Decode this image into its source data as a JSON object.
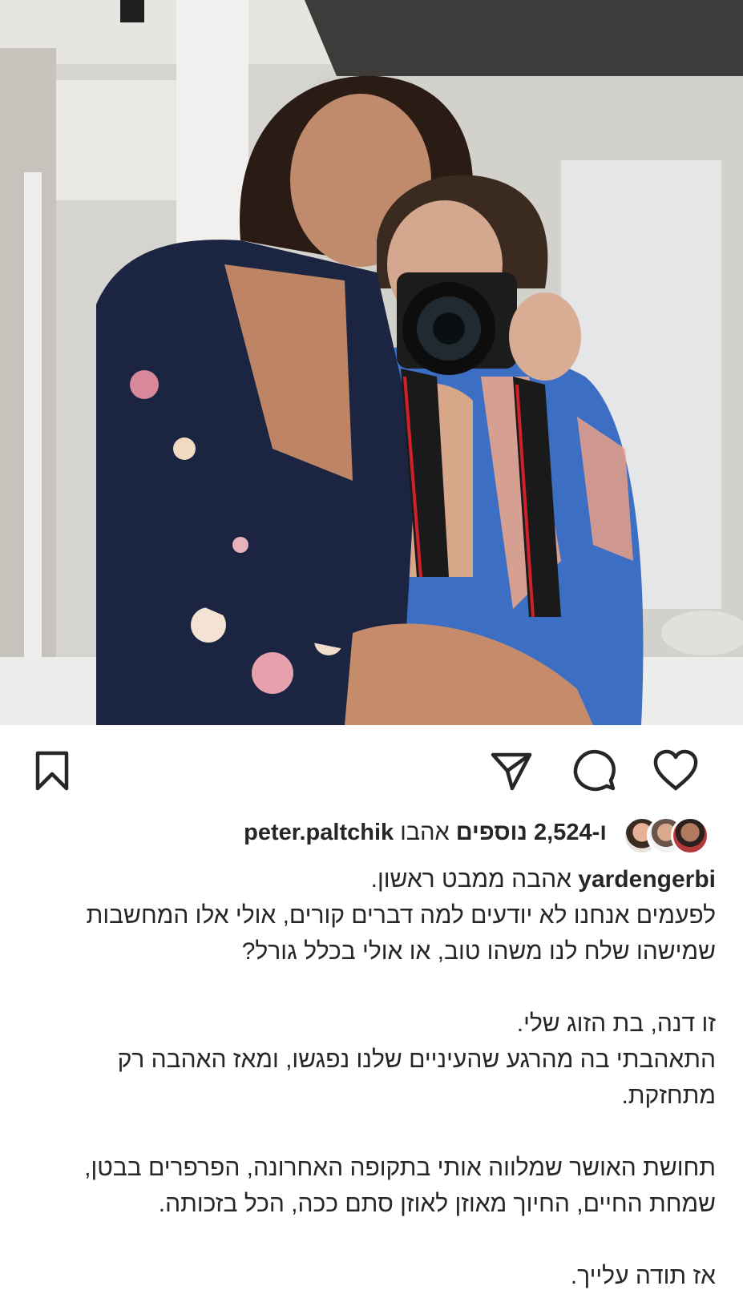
{
  "post": {
    "image_alt": "two women posing with a camera in a bright room",
    "actions": {
      "like": "heart-icon",
      "comment": "comment-icon",
      "share": "send-icon",
      "save": "bookmark-icon"
    },
    "likes": {
      "prefix": "ו-",
      "count": "2,524",
      "others": "נוספים",
      "liked_by": "אהבו",
      "user": "peter.paltchik"
    },
    "caption": {
      "username": "yardengerbi",
      "first_line": "אהבה ממבט ראשון.",
      "lines": [
        "לפעמים אנחנו לא יודעים למה דברים קורים, אולי אלו המחשבות",
        "שמישהו שלח לנו משהו טוב, או אולי בכלל גורל?",
        "",
        "זו דנה, בת הזוג שלי.",
        "התאהבתי בה מהרגע שהעיניים שלנו נפגשו, ומאז האהבה רק",
        "מתחזקת.",
        "",
        "תחושת האושר שמלווה אותי בתקופה האחרונה, הפרפרים בבטן,",
        "שמחת החיים, החיוך מאוזן לאוזן סתם ככה, הכל בזכותה.",
        "",
        "אז תודה עלייך."
      ]
    }
  }
}
